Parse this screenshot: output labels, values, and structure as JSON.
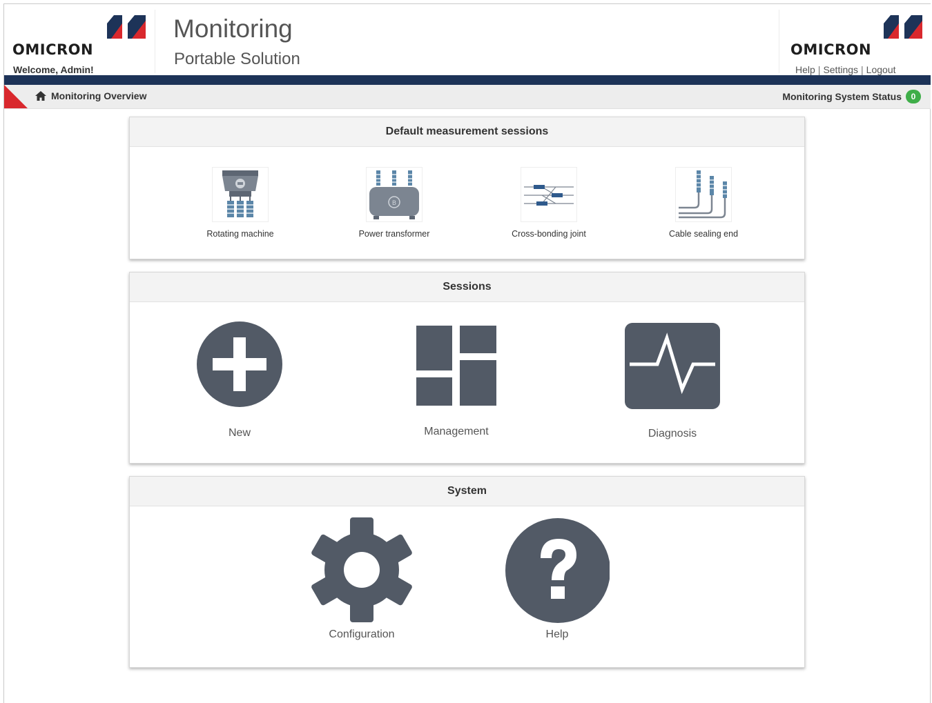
{
  "brand": {
    "name": "OMICRON",
    "colors": {
      "blue": "#1d3358",
      "red": "#d9282d",
      "icon": "#525a66",
      "status_ok": "#3fae49"
    }
  },
  "header": {
    "welcome": "Welcome, Admin!",
    "title": "Monitoring",
    "subtitle": "Portable Solution",
    "links": {
      "help": "Help",
      "settings": "Settings",
      "logout": "Logout",
      "separator": "|"
    }
  },
  "nav": {
    "breadcrumb": "Monitoring Overview",
    "breadcrumb_icon": "home-icon",
    "status_label": "Monitoring System Status",
    "status_count": "0"
  },
  "panels": {
    "default_sessions": {
      "title": "Default measurement sessions",
      "items": [
        {
          "label": "Rotating machine",
          "icon": "rotating-machine-icon"
        },
        {
          "label": "Power transformer",
          "icon": "power-transformer-icon"
        },
        {
          "label": "Cross-bonding joint",
          "icon": "cross-bonding-joint-icon"
        },
        {
          "label": "Cable sealing end",
          "icon": "cable-sealing-end-icon"
        }
      ]
    },
    "sessions": {
      "title": "Sessions",
      "items": [
        {
          "label": "New",
          "icon": "plus-circle-icon"
        },
        {
          "label": "Management",
          "icon": "dashboard-grid-icon"
        },
        {
          "label": "Diagnosis",
          "icon": "pulse-icon"
        }
      ]
    },
    "system": {
      "title": "System",
      "items": [
        {
          "label": "Configuration",
          "icon": "gear-icon"
        },
        {
          "label": "Help",
          "icon": "question-circle-icon"
        }
      ]
    }
  }
}
